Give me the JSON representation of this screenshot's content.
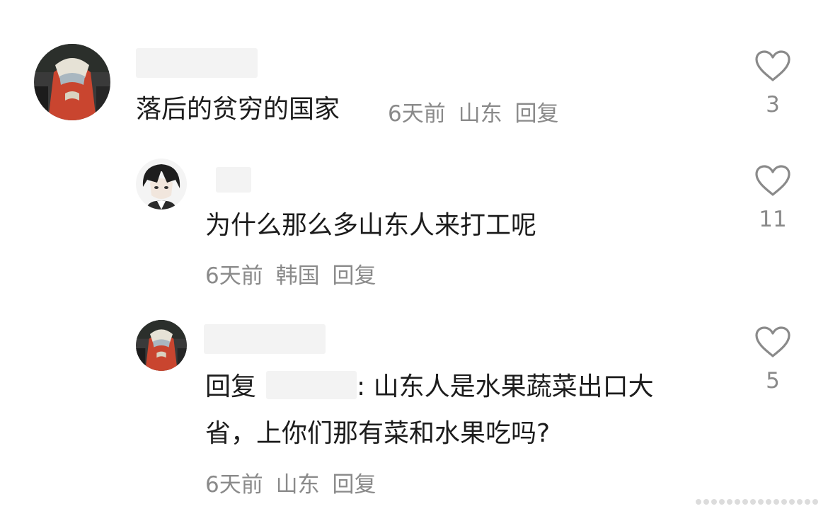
{
  "comments": [
    {
      "text": "落后的贫穷的国家",
      "time": "6天前",
      "location": "山东",
      "reply_label": "回复",
      "likes": "3"
    },
    {
      "text": "为什么那么多山东人来打工呢",
      "time": "6天前",
      "location": "韩国",
      "reply_label": "回复",
      "likes": "11"
    },
    {
      "reply_prefix": "回复",
      "text_line1": ": 山东人是水果蔬菜出口大",
      "text_line2": "省，上你们那有菜和水果吃吗?",
      "time": "6天前",
      "location": "山东",
      "reply_label": "回复",
      "likes": "5"
    }
  ],
  "colors": {
    "text": "#1c1c1c",
    "meta": "#8a8a8a",
    "redaction": "#f3f3f3",
    "heart_outline": "#8a8a8a"
  },
  "icons": {
    "like": "heart-outline-icon"
  }
}
